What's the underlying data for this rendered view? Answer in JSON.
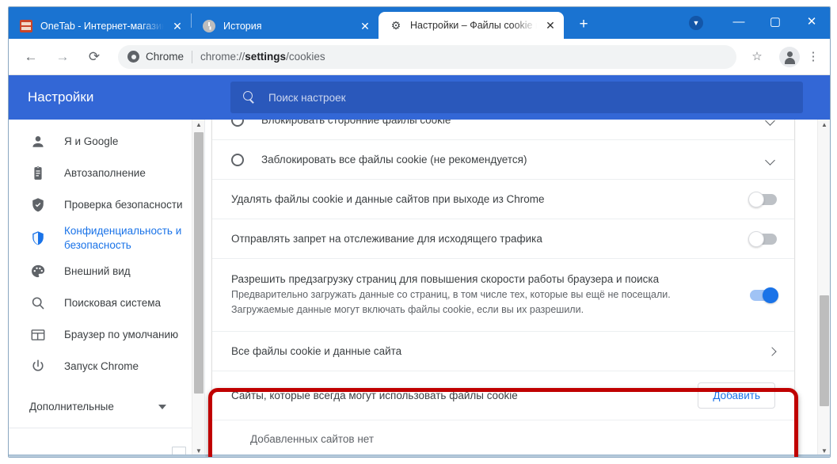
{
  "window": {
    "controls": {
      "minimize": "—",
      "maximize": "▢",
      "close": "✕"
    },
    "tab_search_icon": "chevron-down-circle-icon"
  },
  "tabs": [
    {
      "title": "OneTab - Интернет-магазин Ch",
      "favicon": "onetab-icon",
      "active": false,
      "close": "✕"
    },
    {
      "title": "История",
      "favicon": "history-icon",
      "active": false,
      "close": "✕"
    },
    {
      "title": "Настройки – Файлы cookie и др",
      "favicon": "gear-icon",
      "active": true,
      "close": "✕"
    }
  ],
  "new_tab_label": "+",
  "toolbar": {
    "back_icon": "←",
    "forward_icon": "→",
    "reload_icon": "⟳",
    "scheme_label": "Chrome",
    "url_prefix": "chrome://",
    "url_bold": "settings",
    "url_suffix": "/cookies",
    "bookmark_icon": "☆",
    "profile_icon": "avatar-icon",
    "menu_icon": "⋮"
  },
  "settings": {
    "title": "Настройки",
    "search_placeholder": "Поиск настроек",
    "sidebar": {
      "items": [
        {
          "label": "Я и Google",
          "icon": "person-icon",
          "selected": false
        },
        {
          "label": "Автозаполнение",
          "icon": "clipboard-icon",
          "selected": false
        },
        {
          "label": "Проверка безопасности",
          "icon": "shield-check-icon",
          "selected": false
        },
        {
          "label": "Конфиденциальность и безопасность",
          "icon": "shield-icon",
          "selected": true
        },
        {
          "label": "Внешний вид",
          "icon": "palette-icon",
          "selected": false
        },
        {
          "label": "Поисковая система",
          "icon": "search-icon",
          "selected": false
        },
        {
          "label": "Браузер по умолчанию",
          "icon": "browser-window-icon",
          "selected": false
        },
        {
          "label": "Запуск Chrome",
          "icon": "power-icon",
          "selected": false
        }
      ],
      "advanced_label": "Дополнительные"
    },
    "cookie_options": [
      {
        "label": "Блокировать сторонние файлы cookie",
        "control": "radio",
        "selected": false,
        "expand": "chevron-down-icon"
      },
      {
        "label": "Заблокировать все файлы cookie (не рекомендуется)",
        "control": "radio",
        "selected": false,
        "expand": "chevron-down-icon"
      }
    ],
    "toggle_rows": [
      {
        "label": "Удалять файлы cookie и данные сайтов при выходе из Chrome",
        "on": false
      },
      {
        "label": "Отправлять запрет на отслеживание для исходящего трафика",
        "on": false
      }
    ],
    "preload": {
      "title": "Разрешить предзагрузку страниц для повышения скорости работы браузера и поиска",
      "subtitle_line1": "Предварительно загружать данные со страниц, в том числе тех, которые вы ещё не посещали.",
      "subtitle_line2": "Загружаемые данные могут включать файлы cookie, если вы их разрешили.",
      "on": true,
      "highlight_color": "#c00000"
    },
    "all_cookies_row": {
      "label": "Все файлы cookie и данные сайта",
      "expand": "chevron-right-icon"
    },
    "always_allow": {
      "label": "Сайты, которые всегда могут использовать файлы cookie",
      "add_button": "Добавить",
      "empty_text": "Добавленных сайтов нет"
    }
  },
  "colors": {
    "tabstrip_blue": "#1a73d1",
    "settings_header_blue": "#3367d6",
    "accent_blue": "#1a73e8",
    "highlight_red": "#c00000"
  }
}
